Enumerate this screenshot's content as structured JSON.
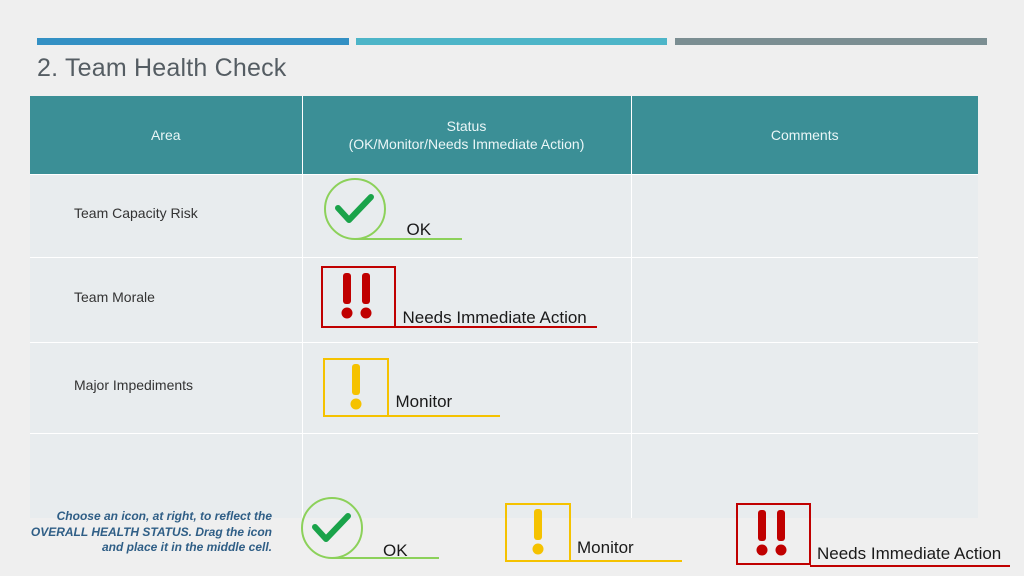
{
  "page": {
    "title": "2. Team Health Check"
  },
  "colors": {
    "header_bg": "#3b8f96",
    "ok_green": "#8cd15a",
    "ok_check": "#1aa34a",
    "monitor_yellow": "#f5c200",
    "action_red": "#c00000"
  },
  "table": {
    "headers": {
      "area": "Area",
      "status_line1": "Status",
      "status_line2": "(OK/Monitor/Needs Immediate Action)",
      "comments": "Comments"
    },
    "rows": [
      {
        "area": "Team Capacity Risk",
        "status": "OK",
        "status_icon": "check-circle-icon",
        "comment": ""
      },
      {
        "area": "Team Morale",
        "status": "Needs Immediate Action",
        "status_icon": "double-exclamation-icon",
        "comment": ""
      },
      {
        "area": "Major Impediments",
        "status": "Monitor",
        "status_icon": "single-exclamation-icon",
        "comment": ""
      },
      {
        "area": "",
        "status": "",
        "comment": ""
      }
    ]
  },
  "legend": {
    "instructions": "Choose an icon, at right, to reflect the OVERALL HEALTH STATUS. Drag the icon and place it in the middle cell.",
    "ok_label": "OK",
    "monitor_label": "Monitor",
    "action_label": "Needs Immediate Action"
  }
}
